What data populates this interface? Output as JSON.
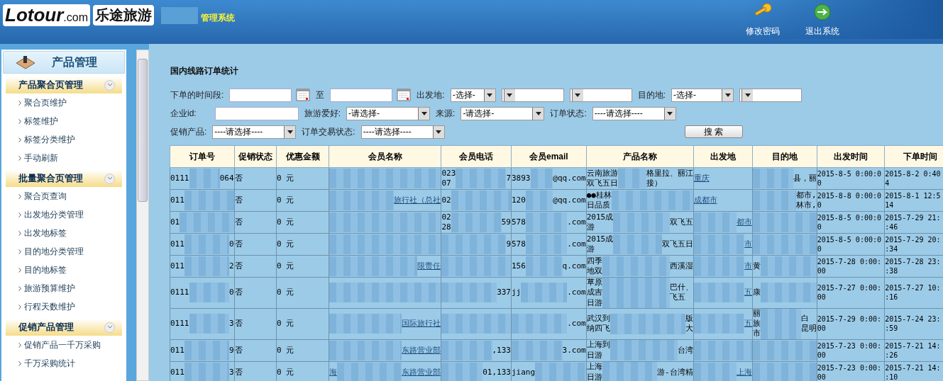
{
  "header": {
    "logo": "Lotour",
    "logo_domain": ".com",
    "logo_cn": "乐途旅游",
    "system_title": "管理系统",
    "actions": [
      {
        "kind": "key",
        "label": "修改密码"
      },
      {
        "kind": "exit",
        "label": "退出系统"
      }
    ]
  },
  "sidebar": {
    "title": "产品管理",
    "groups": [
      {
        "title": "产品聚合页管理",
        "expanded": true,
        "items": [
          "聚合页维护",
          "标签维护",
          "标签分类维护",
          "手动刷新"
        ]
      },
      {
        "title": "批量聚合页管理",
        "expanded": true,
        "items": [
          "聚合页查询",
          "出发地分类管理",
          "出发地标签",
          "目的地分类管理",
          "目的地标签",
          "旅游预算维护",
          "行程天数维护"
        ]
      },
      {
        "title": "促销产品管理",
        "expanded": true,
        "items": [
          "促销产品一千万采购",
          "千万采购统计"
        ]
      }
    ]
  },
  "page_title": "国内线路订单统计",
  "filters": {
    "row1": [
      {
        "kind": "label",
        "text": "下单的时间段:"
      },
      {
        "kind": "date"
      },
      {
        "kind": "label",
        "text": "至"
      },
      {
        "kind": "date"
      },
      {
        "kind": "label",
        "text": "出发地:"
      },
      {
        "kind": "select",
        "value": "-选择-"
      },
      {
        "kind": "select"
      },
      {
        "kind": "select"
      },
      {
        "kind": "label",
        "text": "目的地:"
      },
      {
        "kind": "select",
        "value": "-选择-"
      },
      {
        "kind": "select"
      }
    ],
    "row2": [
      {
        "kind": "label",
        "text": "企业id:"
      },
      {
        "kind": "input"
      },
      {
        "kind": "label",
        "text": "旅游爱好:"
      },
      {
        "kind": "select",
        "value": "-请选择-"
      },
      {
        "kind": "label",
        "text": "来源:"
      },
      {
        "kind": "select",
        "value": "-请选择-"
      },
      {
        "kind": "label",
        "text": "订单状态:"
      },
      {
        "kind": "select",
        "value": "----请选择----"
      }
    ],
    "row3": [
      {
        "kind": "label",
        "text": "促销产品:"
      },
      {
        "kind": "select",
        "value": "----请选择----"
      },
      {
        "kind": "label",
        "text": "订单交易状态:"
      },
      {
        "kind": "select",
        "value": "----请选择----"
      },
      {
        "kind": "button",
        "text": "搜 索"
      }
    ]
  },
  "table": {
    "columns": [
      {
        "label": "订单号",
        "link": false
      },
      {
        "label": "促销状态",
        "link": false
      },
      {
        "label": "优惠金额",
        "link": false
      },
      {
        "label": "会员名称",
        "link": true
      },
      {
        "label": "会员电话",
        "link": false
      },
      {
        "label": "会员email",
        "link": false
      },
      {
        "label": "产品名称",
        "link": false
      },
      {
        "label": "出发地",
        "link": true
      },
      {
        "label": "目的地",
        "link": false
      },
      {
        "label": "出发时间",
        "link": false
      },
      {
        "label": "下单时间",
        "link": false
      }
    ],
    "rows": [
      [
        {
          "text": [
            "0111"
          ],
          "masked": true,
          "tail": [
            "064"
          ]
        },
        {
          "text": [
            "否"
          ]
        },
        {
          "text": [
            "0 元"
          ]
        },
        {
          "masked": true
        },
        {
          "text": [
            "023",
            "07"
          ],
          "masked": true,
          "tail": [
            "7"
          ]
        },
        {
          "text": [
            "3893"
          ],
          "masked": true,
          "tail": [
            "@qq.com"
          ]
        },
        {
          "text": [
            "云南旅游",
            "双飞五日"
          ],
          "masked": true,
          "tail": [
            "格里拉、丽江",
            "接）"
          ]
        },
        {
          "text": [
            "重庆"
          ]
        },
        {
          "masked": true,
          "tail": [
            "县，丽"
          ]
        },
        {
          "text": [
            "2015-8-5 0:00:0",
            "0"
          ]
        },
        {
          "text": [
            "2015-8-2 0:40",
            "4"
          ]
        }
      ],
      [
        {
          "text": [
            "011"
          ],
          "masked": true
        },
        {
          "text": [
            "否"
          ]
        },
        {
          "text": [
            "0 元"
          ]
        },
        {
          "masked": true,
          "tail": [
            "旅行社（总社"
          ]
        },
        {
          "text": [
            "02"
          ],
          "masked": true
        },
        {
          "text": [
            "120"
          ],
          "masked": true,
          "tail": [
            "@qq.com"
          ]
        },
        {
          "text": [
            "●●桂林",
            "日品质"
          ],
          "masked": true
        },
        {
          "text": [
            "成都市"
          ]
        },
        {
          "masked": true,
          "tail": [
            "都市,",
            "林市,"
          ]
        },
        {
          "text": [
            "2015-8-8 0:00:0",
            "0"
          ]
        },
        {
          "text": [
            "2015-8-1 12:5",
            "14"
          ]
        }
      ],
      [
        {
          "text": [
            "01"
          ],
          "masked": true
        },
        {
          "text": [
            "否"
          ]
        },
        {
          "text": [
            "0 元"
          ]
        },
        {
          "masked": true
        },
        {
          "text": [
            "02",
            "28"
          ],
          "masked": true,
          "tail": [
            "59"
          ]
        },
        {
          "text": [
            "578"
          ],
          "masked": true,
          "tail": [
            ".com"
          ]
        },
        {
          "text": [
            "2015成",
            "游"
          ],
          "masked": true,
          "tail": [
            "双飞五"
          ]
        },
        {
          "masked": true,
          "tail": [
            "都市"
          ]
        },
        {
          "masked": true
        },
        {
          "text": [
            "2015-8-5 0:00:0",
            "0"
          ]
        },
        {
          "text": [
            "2015-7-29 21:",
            ":46"
          ]
        }
      ],
      [
        {
          "text": [
            "011"
          ],
          "masked": true,
          "tail": [
            "0"
          ]
        },
        {
          "text": [
            "否"
          ]
        },
        {
          "text": [
            "0 元"
          ]
        },
        {
          "masked": true
        },
        {
          "masked": true,
          "tail": [
            "9"
          ]
        },
        {
          "text": [
            "578"
          ],
          "masked": true,
          "tail": [
            ".com"
          ]
        },
        {
          "text": [
            "2015成",
            "游"
          ],
          "masked": true,
          "tail": [
            "双飞五日"
          ]
        },
        {
          "masked": true,
          "tail": [
            "市"
          ]
        },
        {
          "masked": true
        },
        {
          "text": [
            "2015-8-5 0:00:0",
            "0"
          ]
        },
        {
          "text": [
            "2015-7-29 20:",
            ":34"
          ]
        }
      ],
      [
        {
          "text": [
            "011"
          ],
          "masked": true,
          "tail": [
            "2"
          ]
        },
        {
          "text": [
            "否"
          ]
        },
        {
          "text": [
            "0 元"
          ]
        },
        {
          "masked": true,
          "tail": [
            "限责任"
          ]
        },
        {
          "masked": true
        },
        {
          "text": [
            "156"
          ],
          "masked": true,
          "tail": [
            "q.com"
          ]
        },
        {
          "text": [
            "四季",
            "地双"
          ],
          "masked": true,
          "tail": [
            "西溪湿"
          ]
        },
        {
          "masked": true,
          "tail": [
            "市"
          ]
        },
        {
          "text": [
            "黄"
          ],
          "masked": true
        },
        {
          "text": [
            "2015-7-28 0:00:",
            "00"
          ]
        },
        {
          "text": [
            "2015-7-28 23:",
            ":38"
          ]
        }
      ],
      [
        {
          "text": [
            "0111"
          ],
          "masked": true,
          "tail": [
            "0"
          ]
        },
        {
          "text": [
            "否"
          ]
        },
        {
          "text": [
            "0 元"
          ]
        },
        {
          "masked": true
        },
        {
          "masked": true,
          "tail": [
            "337"
          ]
        },
        {
          "text": [
            "jj"
          ],
          "masked": true,
          "tail": [
            ".com"
          ]
        },
        {
          "text": [
            "草原",
            "成吉",
            "日游"
          ],
          "masked": true,
          "tail": [
            "巴什、",
            "飞五"
          ]
        },
        {
          "masked": true,
          "tail": [
            "五"
          ]
        },
        {
          "text": [
            "康"
          ],
          "masked": true
        },
        {
          "text": [
            "2015-7-27 0:00:",
            "00"
          ]
        },
        {
          "text": [
            "2015-7-27 10:",
            ":16"
          ]
        }
      ],
      [
        {
          "text": [
            "0111"
          ],
          "masked": true,
          "tail": [
            "3"
          ]
        },
        {
          "text": [
            "否"
          ]
        },
        {
          "text": [
            "0 元"
          ]
        },
        {
          "masked": true,
          "tail": [
            "国际旅行社"
          ]
        },
        {
          "masked": true
        },
        {
          "masked": true,
          "tail": [
            ".com"
          ]
        },
        {
          "text": [
            "武汉到",
            "纳四飞"
          ],
          "masked": true,
          "tail": [
            "版",
            "大"
          ]
        },
        {
          "masked": true,
          "tail": [
            "五"
          ]
        },
        {
          "text": [
            "丽",
            "族",
            "市"
          ],
          "masked": true,
          "tail": [
            "白",
            "昆明"
          ]
        },
        {
          "text": [
            "2015-7-29 0:00:",
            "00"
          ]
        },
        {
          "text": [
            "2015-7-24 23:",
            ":59"
          ]
        }
      ],
      [
        {
          "text": [
            "011"
          ],
          "masked": true,
          "tail": [
            "9"
          ]
        },
        {
          "text": [
            "否"
          ]
        },
        {
          "text": [
            "0 元"
          ]
        },
        {
          "masked": true,
          "tail": [
            "东路营业部"
          ]
        },
        {
          "masked": true,
          "tail": [
            ",133"
          ]
        },
        {
          "masked": true,
          "tail": [
            "3.com"
          ]
        },
        {
          "text": [
            "上海到",
            "日游"
          ],
          "masked": true,
          "tail": [
            "台湾"
          ]
        },
        {
          "masked": true
        },
        {
          "masked": true
        },
        {
          "text": [
            "2015-7-23 0:00:",
            "00"
          ]
        },
        {
          "text": [
            "2015-7-21 14:",
            ":26"
          ]
        }
      ],
      [
        {
          "text": [
            "011"
          ],
          "masked": true,
          "tail": [
            "3"
          ]
        },
        {
          "text": [
            "否"
          ]
        },
        {
          "text": [
            "0 元"
          ]
        },
        {
          "text": [
            "海"
          ],
          "masked": true,
          "tail": [
            "东路营业部"
          ]
        },
        {
          "masked": true,
          "tail": [
            "01,133"
          ]
        },
        {
          "text": [
            "jiang"
          ],
          "masked": true
        },
        {
          "text": [
            "上海",
            "日游"
          ],
          "masked": true,
          "tail": [
            "游-台湾精"
          ]
        },
        {
          "masked": true,
          "tail": [
            "上海"
          ]
        },
        {
          "masked": true
        },
        {
          "text": [
            "2015-7-23 0:00:",
            "00"
          ]
        },
        {
          "text": [
            "2015-7-21 14:",
            ":10"
          ]
        }
      ]
    ]
  }
}
